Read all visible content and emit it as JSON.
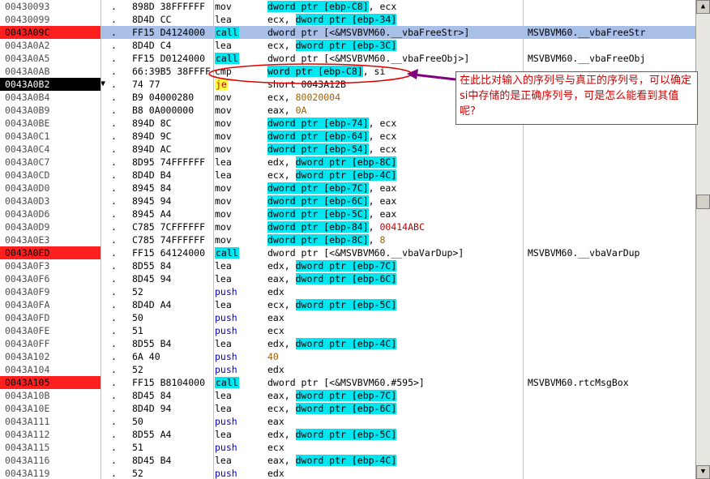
{
  "rows": [
    {
      "addr": "00430093",
      "dot": ".",
      "bytes": "898D 38FFFFFF",
      "mnem": "mov",
      "parts": [
        [
          "dword ptr [ebp-C8]",
          "hl"
        ],
        [
          ", ecx",
          ""
        ]
      ],
      "comment": "",
      "addr_style": "",
      "mnem_style": ""
    },
    {
      "addr": "00430099",
      "dot": ".",
      "bytes": "8D4D CC",
      "mnem": "lea",
      "parts": [
        [
          "ecx, ",
          ""
        ],
        [
          "dword ptr [ebp-34]",
          "hl"
        ]
      ],
      "comment": "",
      "addr_style": "",
      "mnem_style": ""
    },
    {
      "addr": "0043A09C",
      "dot": ".",
      "bytes": "FF15 D4124000",
      "mnem": "call",
      "parts": [
        [
          "dword ptr [<&MSVBVM60.__vbaFreeStr>]",
          ""
        ]
      ],
      "comment": "MSVBVM60.__vbaFreeStr",
      "addr_style": "red",
      "mnem_style": "mhl",
      "selected": true
    },
    {
      "addr": "0043A0A2",
      "dot": ".",
      "bytes": "8D4D C4",
      "mnem": "lea",
      "parts": [
        [
          "ecx, ",
          ""
        ],
        [
          "dword ptr [ebp-3C]",
          "hl"
        ]
      ],
      "comment": "",
      "addr_style": "",
      "mnem_style": ""
    },
    {
      "addr": "0043A0A5",
      "dot": ".",
      "bytes": "FF15 D0124000",
      "mnem": "call",
      "parts": [
        [
          "dword ptr [<&MSVBVM60.__vbaFreeObj>]",
          ""
        ]
      ],
      "comment": "MSVBVM60.__vbaFreeObj",
      "addr_style": "",
      "mnem_style": "mhl"
    },
    {
      "addr": "0043A0AB",
      "dot": ".",
      "bytes": "66:39B5 38FFFF",
      "mnem": "cmp",
      "parts": [
        [
          "word ptr [ebp-C8]",
          "hl"
        ],
        [
          ", si",
          ""
        ]
      ],
      "comment": "",
      "addr_style": "",
      "mnem_style": ""
    },
    {
      "addr": "0043A0B2",
      "dot": ".",
      "bytes": "74 77",
      "mnem": "je",
      "parts": [
        [
          "short 0043A12B",
          ""
        ]
      ],
      "comment": "",
      "addr_style": "blk",
      "mnem_style": "myel",
      "arrow": "▼"
    },
    {
      "addr": "0043A0B4",
      "dot": ".",
      "bytes": "B9 04000280",
      "mnem": "mov",
      "parts": [
        [
          "ecx, ",
          ""
        ],
        [
          "80020004",
          "num"
        ]
      ],
      "comment": "",
      "addr_style": "",
      "mnem_style": ""
    },
    {
      "addr": "0043A0B9",
      "dot": ".",
      "bytes": "B8 0A000000",
      "mnem": "mov",
      "parts": [
        [
          "eax, ",
          ""
        ],
        [
          "0A",
          "num"
        ]
      ],
      "comment": "",
      "addr_style": "",
      "mnem_style": ""
    },
    {
      "addr": "0043A0BE",
      "dot": ".",
      "bytes": "894D 8C",
      "mnem": "mov",
      "parts": [
        [
          "dword ptr [ebp-74]",
          "hl"
        ],
        [
          ", ecx",
          ""
        ]
      ],
      "comment": "",
      "addr_style": "",
      "mnem_style": ""
    },
    {
      "addr": "0043A0C1",
      "dot": ".",
      "bytes": "894D 9C",
      "mnem": "mov",
      "parts": [
        [
          "dword ptr [ebp-64]",
          "hl"
        ],
        [
          ", ecx",
          ""
        ]
      ],
      "comment": "",
      "addr_style": "",
      "mnem_style": ""
    },
    {
      "addr": "0043A0C4",
      "dot": ".",
      "bytes": "894D AC",
      "mnem": "mov",
      "parts": [
        [
          "dword ptr [ebp-54]",
          "hl"
        ],
        [
          ", ecx",
          ""
        ]
      ],
      "comment": "",
      "addr_style": "",
      "mnem_style": ""
    },
    {
      "addr": "0043A0C7",
      "dot": ".",
      "bytes": "8D95 74FFFFFF",
      "mnem": "lea",
      "parts": [
        [
          "edx, ",
          ""
        ],
        [
          "dword ptr [ebp-8C]",
          "hl"
        ]
      ],
      "comment": "",
      "addr_style": "",
      "mnem_style": ""
    },
    {
      "addr": "0043A0CD",
      "dot": ".",
      "bytes": "8D4D B4",
      "mnem": "lea",
      "parts": [
        [
          "ecx, ",
          ""
        ],
        [
          "dword ptr [ebp-4C]",
          "hl"
        ]
      ],
      "comment": "",
      "addr_style": "",
      "mnem_style": ""
    },
    {
      "addr": "0043A0D0",
      "dot": ".",
      "bytes": "8945 84",
      "mnem": "mov",
      "parts": [
        [
          "dword ptr [ebp-7C]",
          "hl"
        ],
        [
          ", eax",
          ""
        ]
      ],
      "comment": "",
      "addr_style": "",
      "mnem_style": ""
    },
    {
      "addr": "0043A0D3",
      "dot": ".",
      "bytes": "8945 94",
      "mnem": "mov",
      "parts": [
        [
          "dword ptr [ebp-6C]",
          "hl"
        ],
        [
          ", eax",
          ""
        ]
      ],
      "comment": "",
      "addr_style": "",
      "mnem_style": ""
    },
    {
      "addr": "0043A0D6",
      "dot": ".",
      "bytes": "8945 A4",
      "mnem": "mov",
      "parts": [
        [
          "dword ptr [ebp-5C]",
          "hl"
        ],
        [
          ", eax",
          ""
        ]
      ],
      "comment": "",
      "addr_style": "",
      "mnem_style": ""
    },
    {
      "addr": "0043A0D9",
      "dot": ".",
      "bytes": "C785 7CFFFFFF",
      "mnem": "mov",
      "parts": [
        [
          "dword ptr [ebp-84]",
          "hl"
        ],
        [
          ", ",
          ""
        ],
        [
          "00414ABC",
          "red"
        ]
      ],
      "comment": "",
      "addr_style": "",
      "mnem_style": ""
    },
    {
      "addr": "0043A0E3",
      "dot": ".",
      "bytes": "C785 74FFFFFF",
      "mnem": "mov",
      "parts": [
        [
          "dword ptr [ebp-8C]",
          "hl"
        ],
        [
          ", ",
          ""
        ],
        [
          "8",
          "num"
        ]
      ],
      "comment": "",
      "addr_style": "",
      "mnem_style": ""
    },
    {
      "addr": "0043A0ED",
      "dot": ".",
      "bytes": "FF15 64124000",
      "mnem": "call",
      "parts": [
        [
          "dword ptr [<&MSVBVM60.__vbaVarDup>]",
          ""
        ]
      ],
      "comment": "MSVBVM60.__vbaVarDup",
      "addr_style": "red",
      "mnem_style": "mhl"
    },
    {
      "addr": "0043A0F3",
      "dot": ".",
      "bytes": "8D55 84",
      "mnem": "lea",
      "parts": [
        [
          "edx, ",
          ""
        ],
        [
          "dword ptr [ebp-7C]",
          "hl"
        ]
      ],
      "comment": "",
      "addr_style": "",
      "mnem_style": ""
    },
    {
      "addr": "0043A0F6",
      "dot": ".",
      "bytes": "8D45 94",
      "mnem": "lea",
      "parts": [
        [
          "eax, ",
          ""
        ],
        [
          "dword ptr [ebp-6C]",
          "hl"
        ]
      ],
      "comment": "",
      "addr_style": "",
      "mnem_style": ""
    },
    {
      "addr": "0043A0F9",
      "dot": ".",
      "bytes": "52",
      "mnem": "push",
      "parts": [
        [
          "edx",
          ""
        ]
      ],
      "comment": "",
      "addr_style": "",
      "mnem_style": "mblue"
    },
    {
      "addr": "0043A0FA",
      "dot": ".",
      "bytes": "8D4D A4",
      "mnem": "lea",
      "parts": [
        [
          "ecx, ",
          ""
        ],
        [
          "dword ptr [ebp-5C]",
          "hl"
        ]
      ],
      "comment": "",
      "addr_style": "",
      "mnem_style": ""
    },
    {
      "addr": "0043A0FD",
      "dot": ".",
      "bytes": "50",
      "mnem": "push",
      "parts": [
        [
          "eax",
          ""
        ]
      ],
      "comment": "",
      "addr_style": "",
      "mnem_style": "mblue"
    },
    {
      "addr": "0043A0FE",
      "dot": ".",
      "bytes": "51",
      "mnem": "push",
      "parts": [
        [
          "ecx",
          ""
        ]
      ],
      "comment": "",
      "addr_style": "",
      "mnem_style": "mblue"
    },
    {
      "addr": "0043A0FF",
      "dot": ".",
      "bytes": "8D55 B4",
      "mnem": "lea",
      "parts": [
        [
          "edx, ",
          ""
        ],
        [
          "dword ptr [ebp-4C]",
          "hl"
        ]
      ],
      "comment": "",
      "addr_style": "",
      "mnem_style": ""
    },
    {
      "addr": "0043A102",
      "dot": ".",
      "bytes": "6A 40",
      "mnem": "push",
      "parts": [
        [
          "40",
          "num"
        ]
      ],
      "comment": "",
      "addr_style": "",
      "mnem_style": "mblue"
    },
    {
      "addr": "0043A104",
      "dot": ".",
      "bytes": "52",
      "mnem": "push",
      "parts": [
        [
          "edx",
          ""
        ]
      ],
      "comment": "",
      "addr_style": "",
      "mnem_style": "mblue"
    },
    {
      "addr": "0043A105",
      "dot": ".",
      "bytes": "FF15 B8104000",
      "mnem": "call",
      "parts": [
        [
          "dword ptr [<&MSVBVM60.#595>]",
          ""
        ]
      ],
      "comment": "MSVBVM60.rtcMsgBox",
      "addr_style": "red",
      "mnem_style": "mhl"
    },
    {
      "addr": "0043A10B",
      "dot": ".",
      "bytes": "8D45 84",
      "mnem": "lea",
      "parts": [
        [
          "eax, ",
          ""
        ],
        [
          "dword ptr [ebp-7C]",
          "hl"
        ]
      ],
      "comment": "",
      "addr_style": "",
      "mnem_style": ""
    },
    {
      "addr": "0043A10E",
      "dot": ".",
      "bytes": "8D4D 94",
      "mnem": "lea",
      "parts": [
        [
          "ecx, ",
          ""
        ],
        [
          "dword ptr [ebp-6C]",
          "hl"
        ]
      ],
      "comment": "",
      "addr_style": "",
      "mnem_style": ""
    },
    {
      "addr": "0043A111",
      "dot": ".",
      "bytes": "50",
      "mnem": "push",
      "parts": [
        [
          "eax",
          ""
        ]
      ],
      "comment": "",
      "addr_style": "",
      "mnem_style": "mblue"
    },
    {
      "addr": "0043A112",
      "dot": ".",
      "bytes": "8D55 A4",
      "mnem": "lea",
      "parts": [
        [
          "edx, ",
          ""
        ],
        [
          "dword ptr [ebp-5C]",
          "hl"
        ]
      ],
      "comment": "",
      "addr_style": "",
      "mnem_style": ""
    },
    {
      "addr": "0043A115",
      "dot": ".",
      "bytes": "51",
      "mnem": "push",
      "parts": [
        [
          "ecx",
          ""
        ]
      ],
      "comment": "",
      "addr_style": "",
      "mnem_style": "mblue"
    },
    {
      "addr": "0043A116",
      "dot": ".",
      "bytes": "8D45 B4",
      "mnem": "lea",
      "parts": [
        [
          "eax, ",
          ""
        ],
        [
          "dword ptr [ebp-4C]",
          "hl"
        ]
      ],
      "comment": "",
      "addr_style": "",
      "mnem_style": ""
    },
    {
      "addr": "0043A119",
      "dot": ".",
      "bytes": "52",
      "mnem": "push",
      "parts": [
        [
          "edx",
          ""
        ]
      ],
      "comment": "",
      "addr_style": "",
      "mnem_style": "mblue"
    }
  ],
  "annotation": {
    "text": "在此比对输入的序列号与真正的序列号，可以确定si中存储的是正确序列号，可是怎么能看到其值呢?",
    "color": "#d00000",
    "arrow_color": "#800080",
    "ellipse_color": "#e00000"
  },
  "scrollbar": {
    "up_icon": "▲",
    "down_icon": "▼"
  },
  "colors": {
    "highlight": "#00e5f0",
    "breakpoint": "#ff1f1f",
    "selection": "#a8c0e8",
    "je_bg": "#ffff40"
  }
}
